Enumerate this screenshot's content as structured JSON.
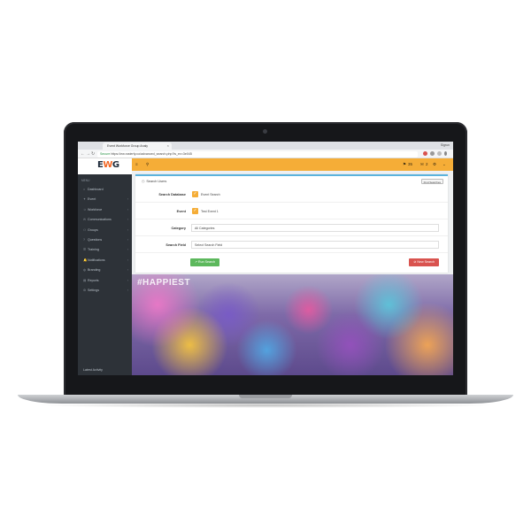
{
  "browser": {
    "tab_title": "Event Workforce Group Analy",
    "tab_close": "×",
    "user": "Sigrun",
    "secure_label": "Secure",
    "url": "https://ew.rosterfy.co/advanced_search.php?is_ev=3e045",
    "back": "←",
    "forward": "→",
    "reload": "↻"
  },
  "app": {
    "logo_pre": "E",
    "logo_mid": "W",
    "logo_post": "G",
    "menu_title": "MENU",
    "sidebar": [
      {
        "icon": "⌂",
        "label": "Dashboard",
        "chevron": ""
      },
      {
        "icon": "✦",
        "label": "Event",
        "chevron": "›"
      },
      {
        "icon": "☺",
        "label": "Workforce",
        "chevron": "›"
      },
      {
        "icon": "✉",
        "label": "Communications",
        "chevron": "›"
      },
      {
        "icon": "⚇",
        "label": "Groups",
        "chevron": "›"
      },
      {
        "icon": "?",
        "label": "Questions",
        "chevron": "›"
      },
      {
        "icon": "☰",
        "label": "Training",
        "chevron": "›"
      },
      {
        "icon": "🔔",
        "label": "Notifications",
        "chevron": "›"
      },
      {
        "icon": "◍",
        "label": "Branding",
        "chevron": "›"
      },
      {
        "icon": "▤",
        "label": "Reports",
        "chevron": "›"
      },
      {
        "icon": "⚙",
        "label": "Settings",
        "chevron": "›"
      }
    ],
    "latest_activity": "Latest Activity",
    "topbar": {
      "menu_icon": "≡",
      "search_icon": "⚲",
      "flag_count": "35",
      "msg_count": "2",
      "gear": "⚙",
      "caret": "⌄"
    }
  },
  "panel": {
    "title": "Search Users",
    "find_button": "Find Searches",
    "rows": {
      "database_label": "Search Database",
      "database_value": "Event Search",
      "event_label": "Event",
      "event_value": "Test Event 1",
      "category_label": "Category",
      "category_value": "All Categories",
      "field_label": "Search Field",
      "field_value": "Select Search Field"
    },
    "checkmark": "✓",
    "run_button": "↗ Run Search",
    "new_button": "⊘ New Search"
  },
  "hero": {
    "hashtag": "#HAPPIEST"
  },
  "colors": {
    "accent": "#f5ad37",
    "sidebar_bg": "#2d3238",
    "run_green": "#5cb85c",
    "new_red": "#d9534f",
    "panel_border": "#5bb3dd"
  }
}
